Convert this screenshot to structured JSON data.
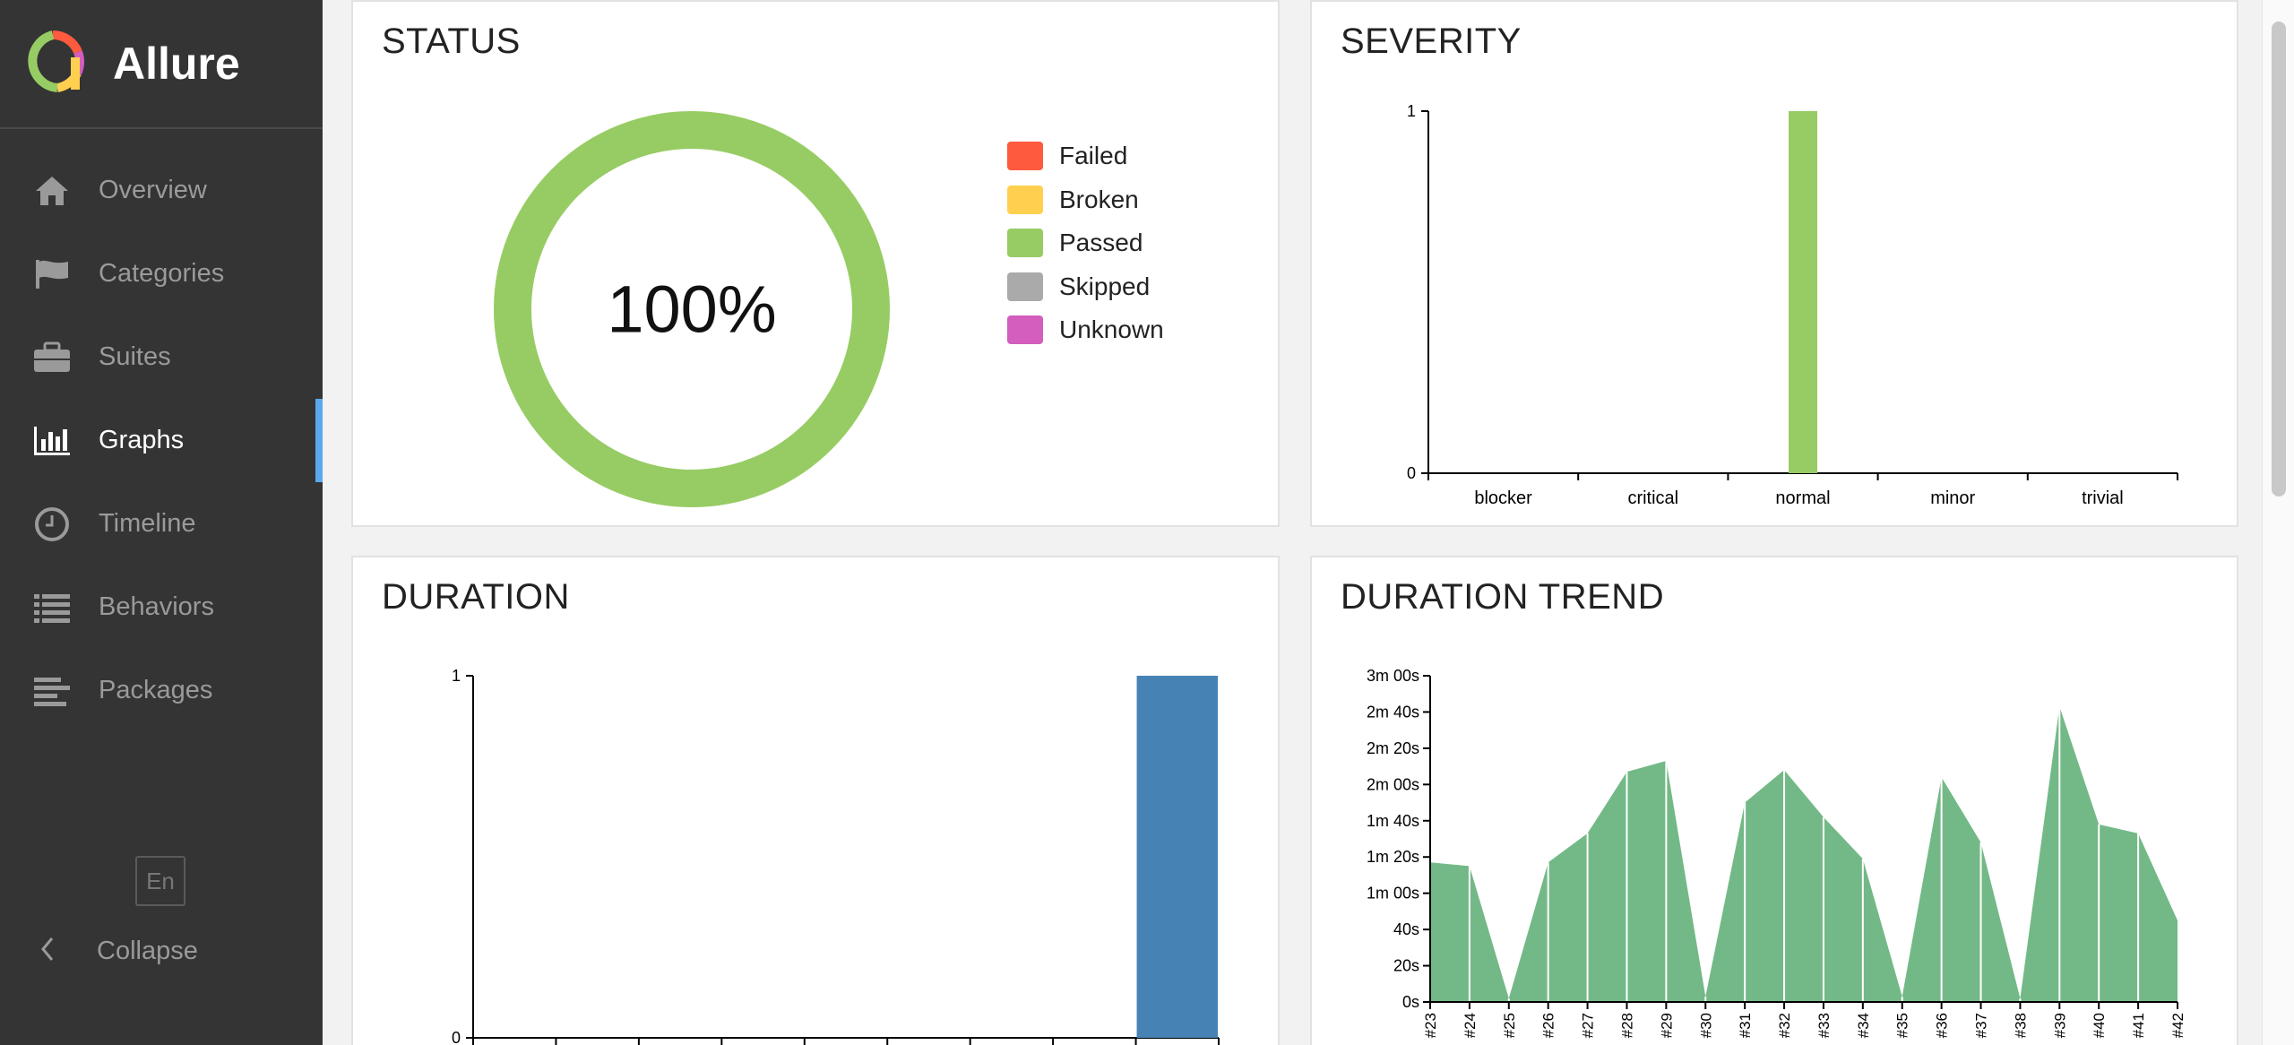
{
  "app": {
    "title": "Allure",
    "logo": "allure-logo-icon"
  },
  "sidebar": {
    "items": [
      {
        "label": "Overview",
        "icon": "home-icon",
        "active": false
      },
      {
        "label": "Categories",
        "icon": "flag-icon",
        "active": false
      },
      {
        "label": "Suites",
        "icon": "briefcase-icon",
        "active": false
      },
      {
        "label": "Graphs",
        "icon": "bar-chart-icon",
        "active": true
      },
      {
        "label": "Timeline",
        "icon": "clock-icon",
        "active": false
      },
      {
        "label": "Behaviors",
        "icon": "list-icon",
        "active": false
      },
      {
        "label": "Packages",
        "icon": "align-left-icon",
        "active": false
      }
    ],
    "language": "En",
    "collapse_label": "Collapse"
  },
  "widgets": {
    "status": {
      "title": "STATUS",
      "percent": "100%",
      "legend": [
        {
          "label": "Failed",
          "color": "#fd5a3e"
        },
        {
          "label": "Broken",
          "color": "#ffd050"
        },
        {
          "label": "Passed",
          "color": "#97cc64"
        },
        {
          "label": "Skipped",
          "color": "#aaaaaa"
        },
        {
          "label": "Unknown",
          "color": "#d35ebe"
        }
      ]
    },
    "severity": {
      "title": "SEVERITY"
    },
    "duration": {
      "title": "DURATION"
    },
    "trend": {
      "title": "DURATION TREND"
    }
  },
  "chart_data": [
    {
      "type": "pie",
      "title": "STATUS",
      "categories": [
        "Failed",
        "Broken",
        "Passed",
        "Skipped",
        "Unknown"
      ],
      "values": [
        0,
        0,
        1,
        0,
        0
      ],
      "center_label": "100%",
      "legend": "right"
    },
    {
      "type": "bar",
      "title": "SEVERITY",
      "categories": [
        "blocker",
        "critical",
        "normal",
        "minor",
        "trivial"
      ],
      "values": [
        0,
        0,
        1,
        0,
        0
      ],
      "ylim": [
        0,
        1
      ],
      "yticks": [
        "0",
        "1"
      ],
      "color": "#97cc64"
    },
    {
      "type": "bar",
      "title": "DURATION",
      "bins": 9,
      "values": [
        0,
        0,
        0,
        0,
        0,
        0,
        0,
        0,
        1
      ],
      "ylim": [
        0,
        1
      ],
      "yticks": [
        "0",
        "1"
      ],
      "color": "#4682b4"
    },
    {
      "type": "area",
      "title": "DURATION TREND",
      "categories": [
        "#23",
        "#24",
        "#25",
        "#26",
        "#27",
        "#28",
        "#29",
        "#30",
        "#31",
        "#32",
        "#33",
        "#34",
        "#35",
        "#36",
        "#37",
        "#38",
        "#39",
        "#40",
        "#41",
        "#42"
      ],
      "values": [
        77,
        75,
        2,
        77,
        93,
        127,
        133,
        3,
        110,
        128,
        102,
        79,
        3,
        124,
        88,
        2,
        163,
        98,
        93,
        45
      ],
      "ylim": [
        0,
        180
      ],
      "yticks": [
        "0s",
        "20s",
        "40s",
        "1m 00s",
        "1m 20s",
        "1m 40s",
        "2m 00s",
        "2m 20s",
        "2m 40s",
        "3m 00s"
      ],
      "color": "#73b987"
    }
  ]
}
